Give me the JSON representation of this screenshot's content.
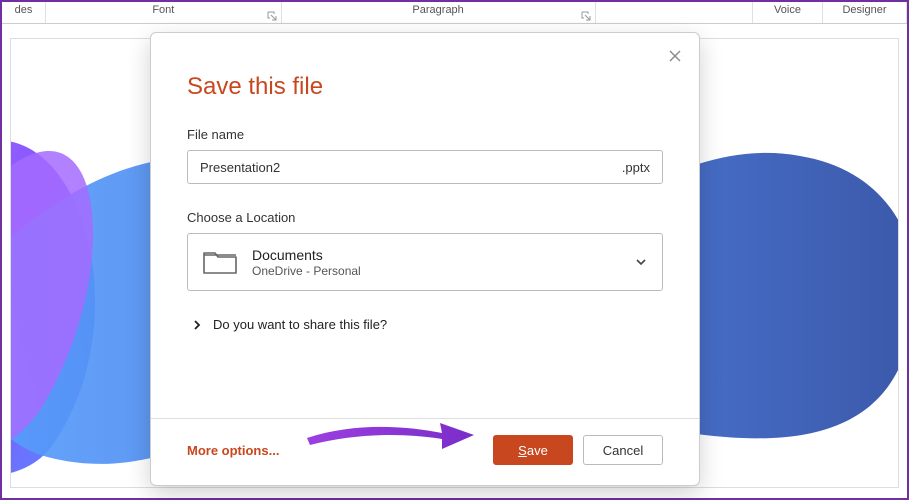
{
  "ribbon": {
    "tab0": "des",
    "font_group": "Font",
    "paragraph_group": "Paragraph",
    "voice_group": "Voice",
    "designer_group": "Designer"
  },
  "dialog": {
    "title": "Save this file",
    "file_name_label": "File name",
    "file_name_value": "Presentation2",
    "extension": ".pptx",
    "location_label": "Choose a Location",
    "location_name": "Documents",
    "location_path": "OneDrive - Personal",
    "share_question": "Do you want to share this file?",
    "more_options": "More options...",
    "save_label": "ave",
    "save_prefix": "S",
    "cancel_label": "Cancel"
  }
}
